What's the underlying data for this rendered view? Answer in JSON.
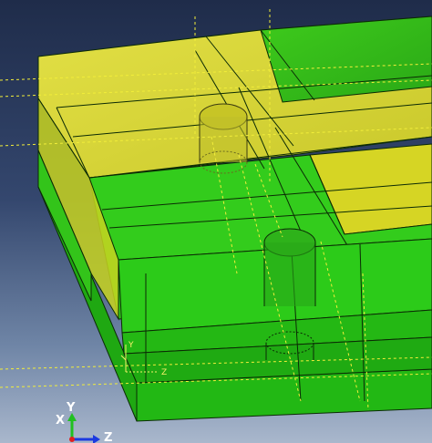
{
  "viewport": {
    "background_top": "#1f2c4a",
    "background_bottom": "#a9b7cc"
  },
  "model": {
    "colors": {
      "part_green": "#27d11a",
      "part_yellow": "#d8d824",
      "edge": "#0b2a05",
      "datum_lines": "#f2ee3a"
    }
  },
  "local_csys": {
    "y_label": "Y",
    "z_label": "Z"
  },
  "view_triad": {
    "x_label": "X",
    "y_label": "Y",
    "z_label": "Z",
    "colors": {
      "x": "#e02020",
      "y": "#20c020",
      "z": "#1c3ae0"
    }
  }
}
